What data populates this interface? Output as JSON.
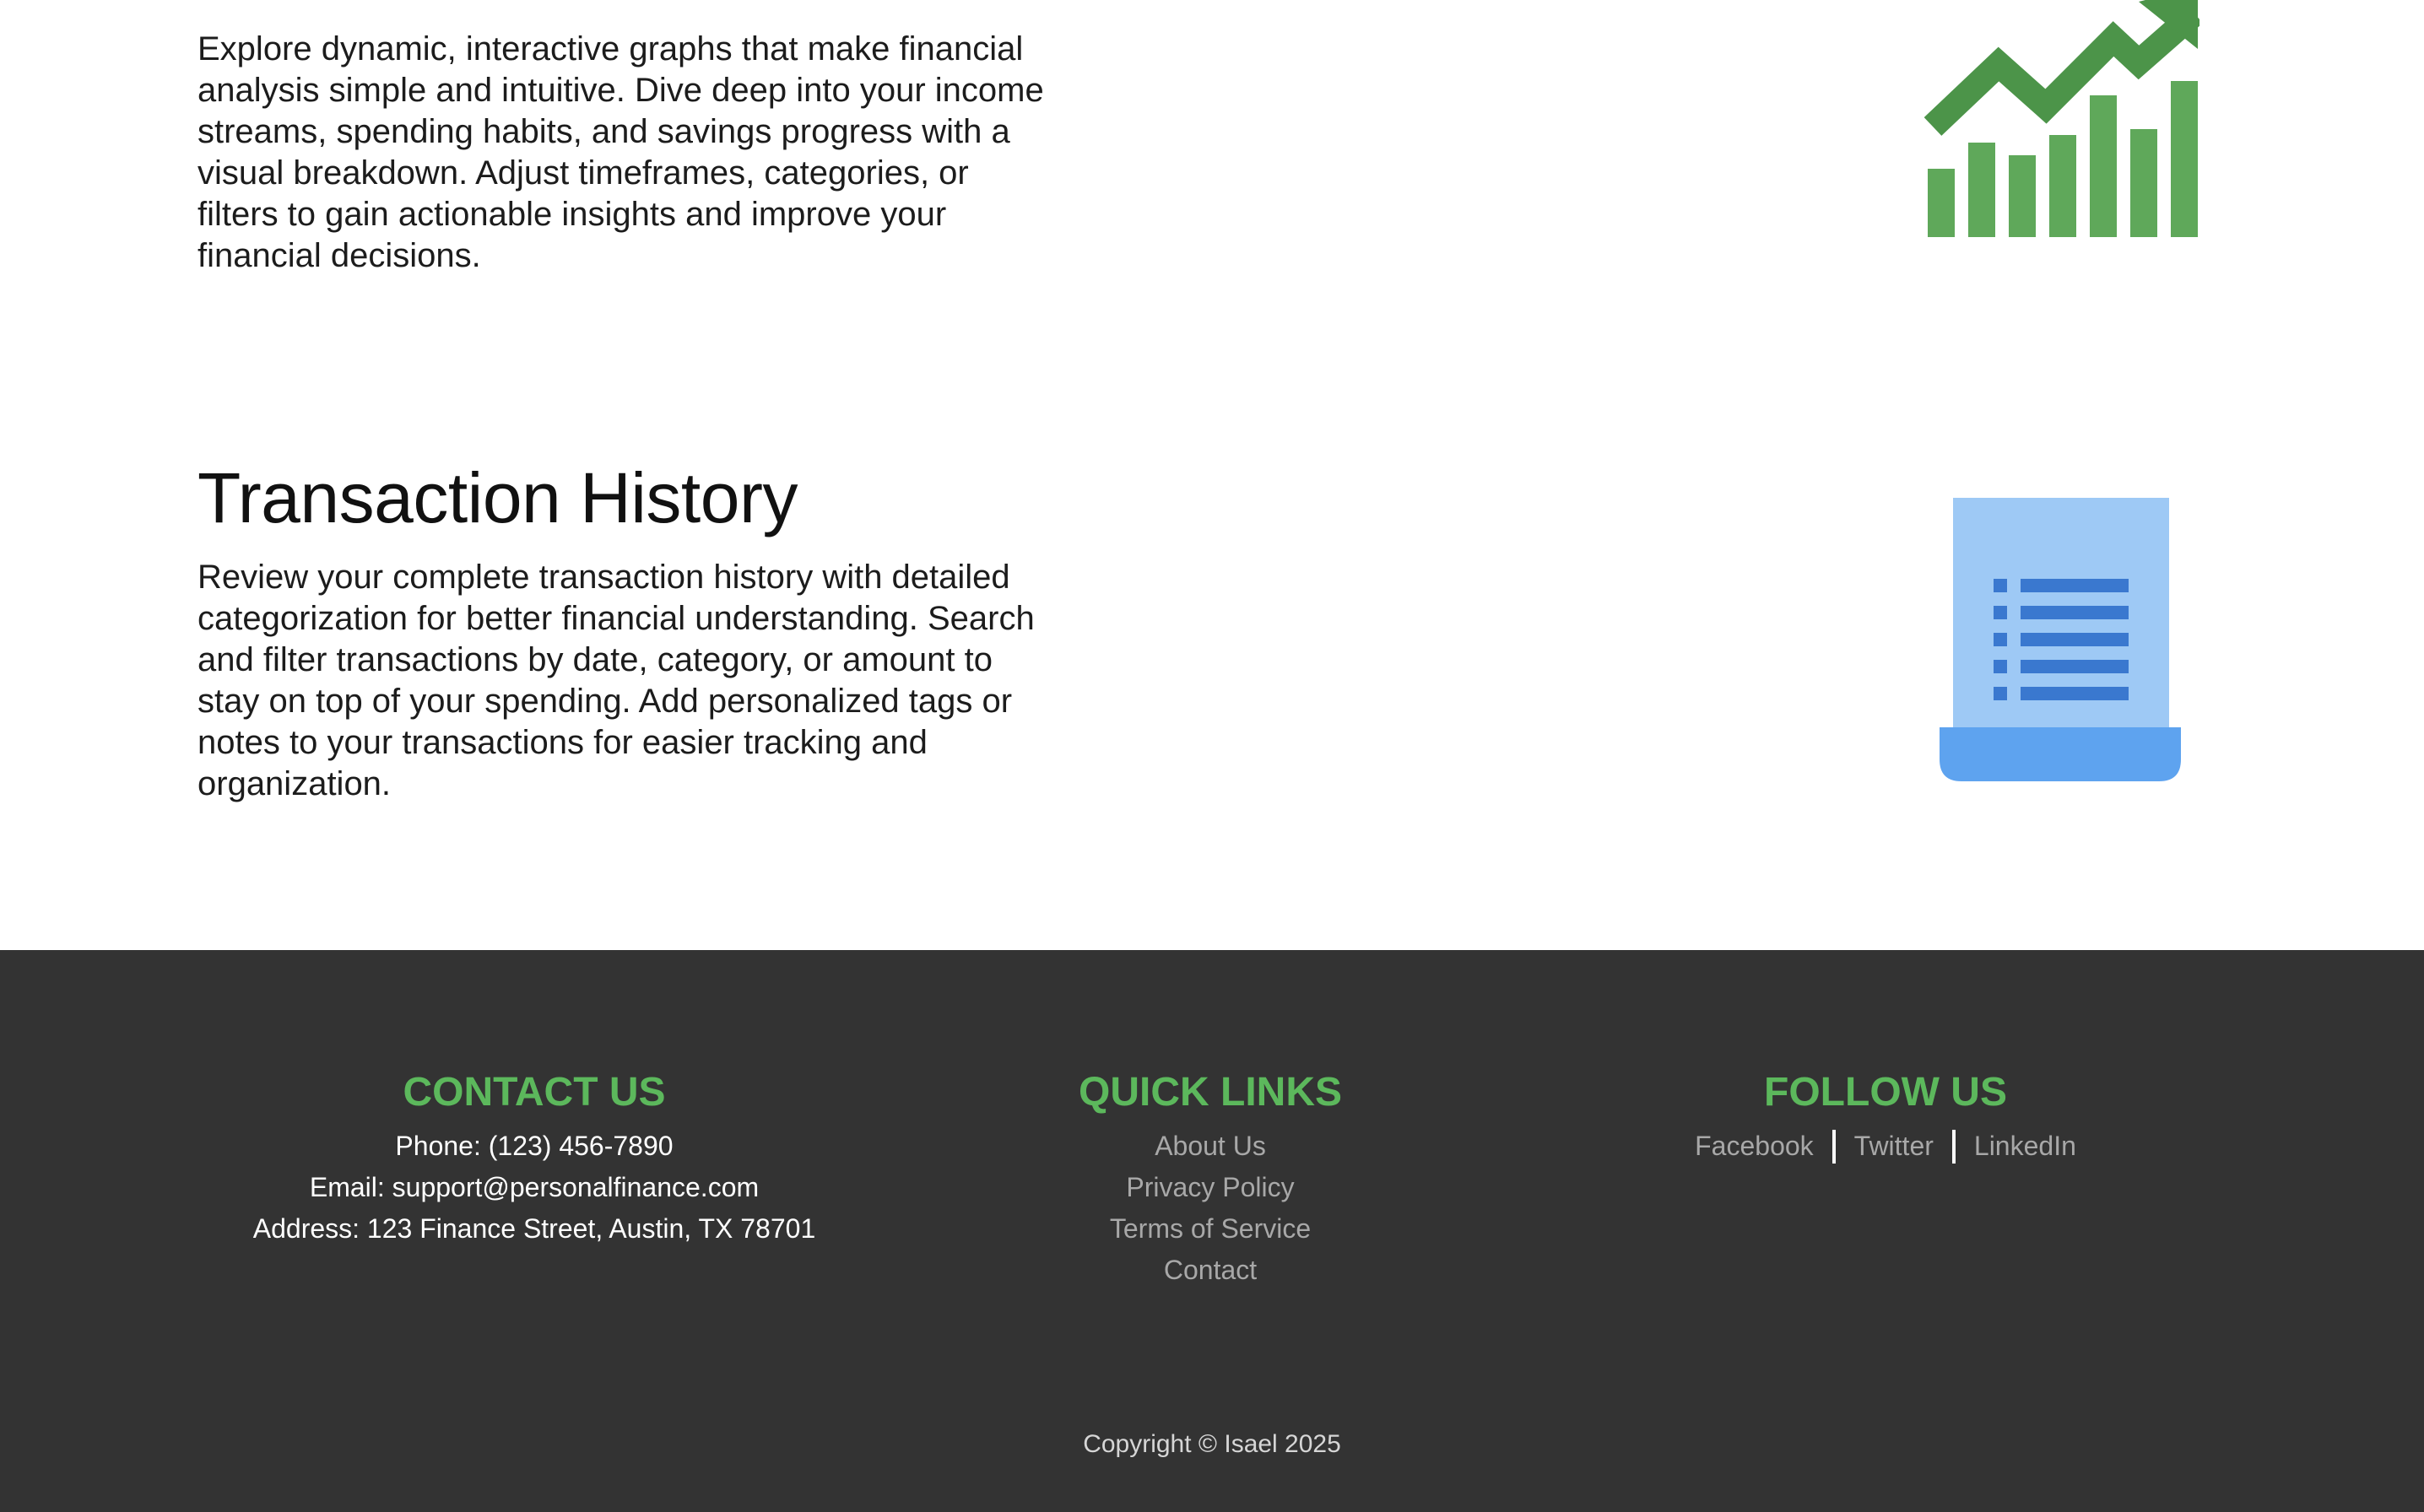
{
  "sections": {
    "graphs": {
      "description": "Explore dynamic, interactive graphs that make financial analysis simple and intuitive. Dive deep into your income streams, spending habits, and savings progress with a visual breakdown. Adjust timeframes, categories, or filters to gain actionable insights and improve your financial decisions.",
      "icon": "growth-chart-icon",
      "icon_color": "#5fa85a"
    },
    "history": {
      "title": "Transaction History",
      "description": "Review your complete transaction history with detailed categorization for better financial understanding. Search and filter transactions by date, category, or amount to stay on top of your spending. Add personalized tags or notes to your transactions for easier tracking and organization.",
      "icon": "receipt-icon",
      "icon_colors": {
        "paper": "#9ec9f5",
        "lines": "#3a78cf",
        "tray": "#5ea3ef"
      }
    }
  },
  "footer": {
    "background": "#333333",
    "accent": "#5cb85c",
    "contact": {
      "heading": "CONTACT US",
      "phone": "Phone: (123) 456-7890",
      "email": "Email: support@personalfinance.com",
      "address": "Address: 123 Finance Street, Austin, TX 78701"
    },
    "quick_links": {
      "heading": "QUICK LINKS",
      "items": [
        "About Us",
        "Privacy Policy",
        "Terms of Service",
        "Contact"
      ]
    },
    "follow": {
      "heading": "FOLLOW US",
      "items": [
        "Facebook",
        "Twitter",
        "LinkedIn"
      ]
    },
    "copyright": "Copyright © Isael 2025"
  }
}
